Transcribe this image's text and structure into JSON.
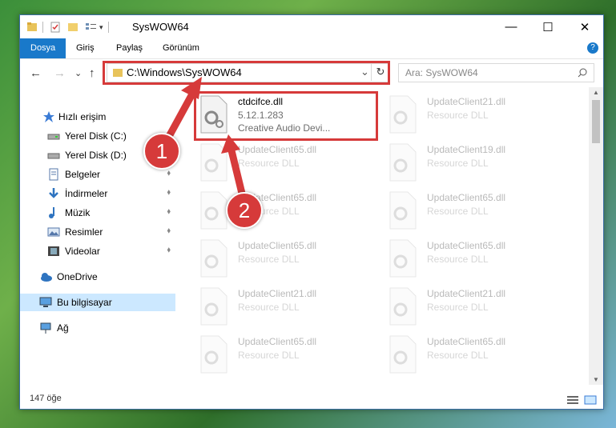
{
  "window": {
    "title": "SysWOW64",
    "minimize_glyph": "—",
    "maximize_glyph": "☐",
    "close_glyph": "✕"
  },
  "ribbon": {
    "tabs": [
      "Dosya",
      "Giriş",
      "Paylaş",
      "Görünüm"
    ]
  },
  "address": {
    "path": "C:\\Windows\\SysWOW64",
    "dropdown_glyph": "⌄",
    "refresh_glyph": "↻"
  },
  "search": {
    "placeholder": "Ara: SysWOW64"
  },
  "nav_buttons": {
    "back": "←",
    "forward": "→",
    "recent": "⌄",
    "up": "↑"
  },
  "sidebar": {
    "items": [
      {
        "label": "Hızlı erişim"
      },
      {
        "label": "Yerel Disk (C:)"
      },
      {
        "label": "Yerel Disk (D:)"
      },
      {
        "label": "Belgeler"
      },
      {
        "label": "İndirmeler"
      },
      {
        "label": "Müzik"
      },
      {
        "label": "Resimler"
      },
      {
        "label": "Videolar"
      },
      {
        "label": "OneDrive"
      },
      {
        "label": "Bu bilgisayar"
      },
      {
        "label": "Ağ"
      }
    ],
    "pin_glyph": "📌"
  },
  "files": [
    {
      "name": "ctdcifce.dll",
      "line2": "5.12.1.283",
      "line3": "Creative Audio Devi..."
    },
    {
      "name": "UpdateClient21.dll",
      "line2": "Resource DLL"
    },
    {
      "name": "UpdateClient65.dll",
      "line2": "Resource DLL"
    },
    {
      "name": "UpdateClient19.dll",
      "line2": "Resource DLL"
    },
    {
      "name": "UpdateClient65.dll",
      "line2": "Resource DLL"
    },
    {
      "name": "UpdateClient65.dll",
      "line2": "Resource DLL"
    },
    {
      "name": "UpdateClient65.dll",
      "line2": "Resource DLL"
    },
    {
      "name": "UpdateClient65.dll",
      "line2": "Resource DLL"
    },
    {
      "name": "UpdateClient21.dll",
      "line2": "Resource DLL"
    },
    {
      "name": "UpdateClient21.dll",
      "line2": "Resource DLL"
    },
    {
      "name": "UpdateClient65.dll",
      "line2": "Resource DLL"
    },
    {
      "name": "UpdateClient65.dll",
      "line2": "Resource DLL"
    }
  ],
  "status": {
    "count": "147 öğe"
  },
  "callouts": {
    "one": "1",
    "two": "2"
  },
  "colors": {
    "accent": "#1979ca",
    "highlight": "#d63a3a",
    "selection": "#cce8ff"
  }
}
